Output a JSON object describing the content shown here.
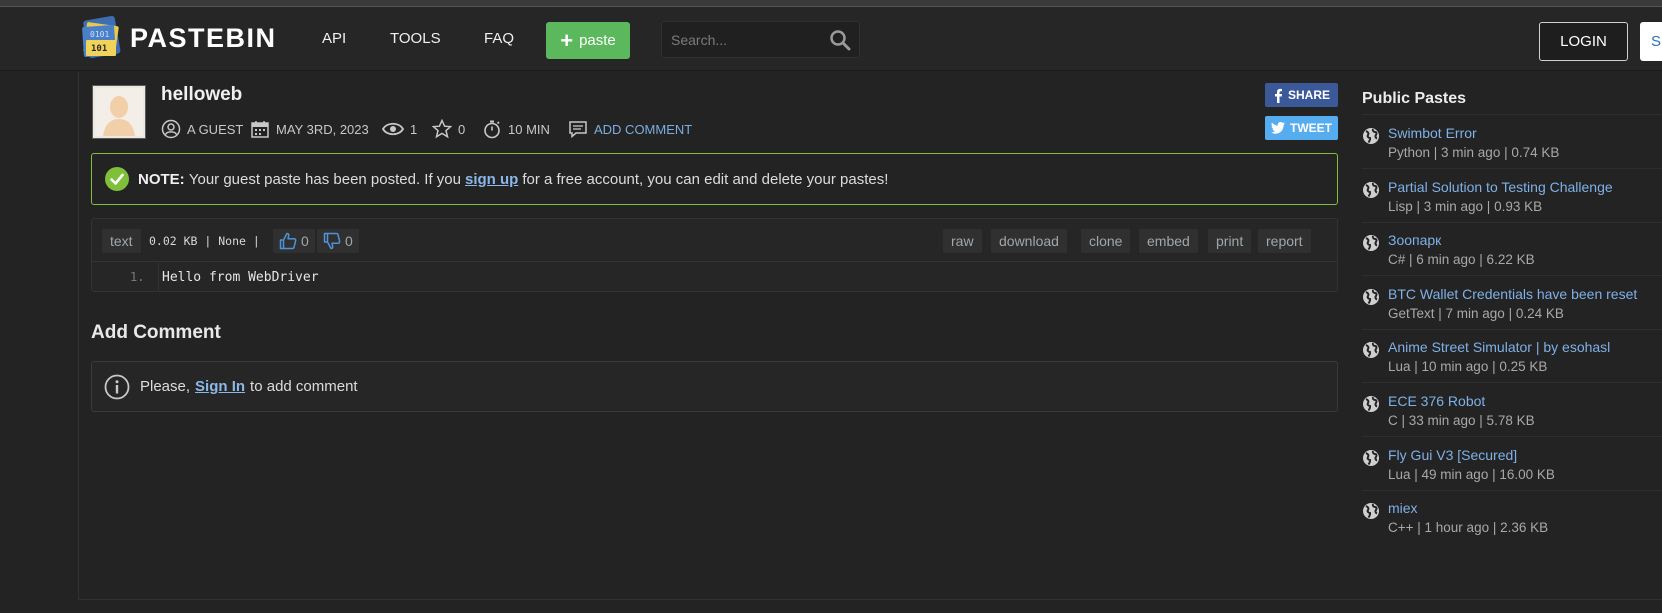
{
  "header": {
    "logo_text": "PASTEBIN",
    "nav": [
      "API",
      "TOOLS",
      "FAQ"
    ],
    "paste_button": "paste",
    "search_placeholder": "Search...",
    "login": "LOGIN",
    "signup": "S"
  },
  "paste": {
    "title": "helloweb",
    "author": "A GUEST",
    "date": "MAY 3RD, 2023",
    "views": "1",
    "stars": "0",
    "expiry": "10 MIN",
    "add_comment": "ADD COMMENT",
    "share": "SHARE",
    "tweet": "TWEET"
  },
  "notice": {
    "label": "NOTE:",
    "text_before": "Your guest paste has been posted. If you",
    "link": "sign up",
    "text_after": "for a free account, you can edit and delete your pastes!"
  },
  "code": {
    "syntax": "text",
    "info": "0.02 KB | None |",
    "likes": "0",
    "dislikes": "0",
    "actions": [
      "raw",
      "download",
      "clone",
      "embed",
      "print",
      "report"
    ],
    "line_no": "1.",
    "line": "Hello from WebDriver"
  },
  "comments": {
    "heading": "Add Comment",
    "prefix": "Please,",
    "link": "Sign In",
    "suffix": "to add comment"
  },
  "sidebar": {
    "title": "Public Pastes",
    "items": [
      {
        "title": "Swimbot Error",
        "meta": "Python | 3 min ago | 0.74 KB"
      },
      {
        "title": "Partial Solution to Testing Challenge",
        "meta": "Lisp | 3 min ago | 0.93 KB"
      },
      {
        "title": "Зоопарк",
        "meta": "C# | 6 min ago | 6.22 KB"
      },
      {
        "title": "BTC Wallet Credentials have been reset",
        "meta": "GetText | 7 min ago | 0.24 KB"
      },
      {
        "title": "Anime Street Simulator | by esohasl",
        "meta": "Lua | 10 min ago | 0.25 KB"
      },
      {
        "title": "ECE 376 Robot",
        "meta": "C | 33 min ago | 5.78 KB"
      },
      {
        "title": "Fly Gui V3 [Secured]",
        "meta": "Lua | 49 min ago | 16.00 KB"
      },
      {
        "title": "miex",
        "meta": "C++ | 1 hour ago | 2.36 KB"
      }
    ]
  },
  "colors": {
    "background": "#232323",
    "header": "#262626",
    "accent_green": "#5cb85c",
    "link_blue": "#7fb0e6",
    "facebook": "#3b5998",
    "twitter": "#55acee",
    "notice_border": "#7fbf3a"
  }
}
